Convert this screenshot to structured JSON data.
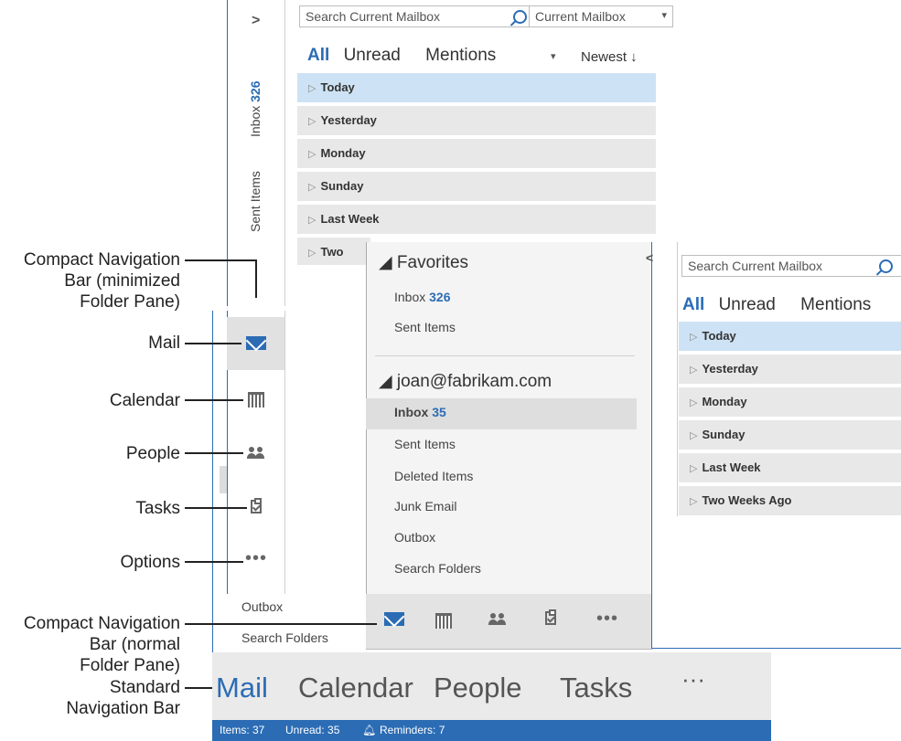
{
  "back_window": {
    "expand_chevron": ">",
    "vertical_folders": [
      {
        "label": "Inbox",
        "count": "326"
      },
      {
        "label": "Sent Items",
        "count": ""
      }
    ],
    "search_placeholder": "Search Current Mailbox",
    "scope": "Current Mailbox",
    "scope_arrow": "▾",
    "filters": [
      "All",
      "Unread",
      "Mentions"
    ],
    "filter_arrow": "▾",
    "sort": "Newest ↓",
    "groups": [
      "Today",
      "Yesterday",
      "Monday",
      "Sunday",
      "Last Week",
      "Two"
    ]
  },
  "front_window": {
    "collapse_chevron": "<",
    "favorites_header": "◢ Favorites",
    "favorites": [
      {
        "label": "Inbox",
        "count": "326"
      },
      {
        "label": "Sent Items",
        "count": ""
      }
    ],
    "account_header": "◢ joan@fabrikam.com",
    "account_folders": [
      {
        "label": "Inbox",
        "count": "35"
      },
      {
        "label": "Sent Items",
        "count": ""
      },
      {
        "label": "Deleted Items",
        "count": ""
      },
      {
        "label": "Junk Email",
        "count": ""
      },
      {
        "label": "Outbox",
        "count": ""
      },
      {
        "label": "Search Folders",
        "count": ""
      }
    ],
    "search_placeholder": "Search Current Mailbox",
    "filters": [
      "All",
      "Unread",
      "Mentions"
    ],
    "groups": [
      "Today",
      "Yesterday",
      "Monday",
      "Sunday",
      "Last Week",
      "Two Weeks Ago"
    ]
  },
  "left_column_folders": [
    "Outbox",
    "Search Folders"
  ],
  "standard_nav": {
    "items": [
      "Mail",
      "Calendar",
      "People",
      "Tasks"
    ],
    "more": "···"
  },
  "status_bar": {
    "items": "Items: 37",
    "unread": "Unread: 35",
    "reminders": "Reminders: 7"
  },
  "callouts": {
    "compact_min": [
      "Compact Navigation",
      "Bar (minimized",
      "Folder Pane)"
    ],
    "mail": "Mail",
    "calendar": "Calendar",
    "people": "People",
    "tasks": "Tasks",
    "options": "Options",
    "compact_normal": [
      "Compact Navigation",
      "Bar (normal",
      "Folder Pane)"
    ],
    "standard": [
      "Standard",
      "Navigation Bar"
    ]
  },
  "colors": {
    "accent": "#2b6cb4",
    "selected_row": "#cde3f5",
    "group_row": "#e8e8e8"
  }
}
